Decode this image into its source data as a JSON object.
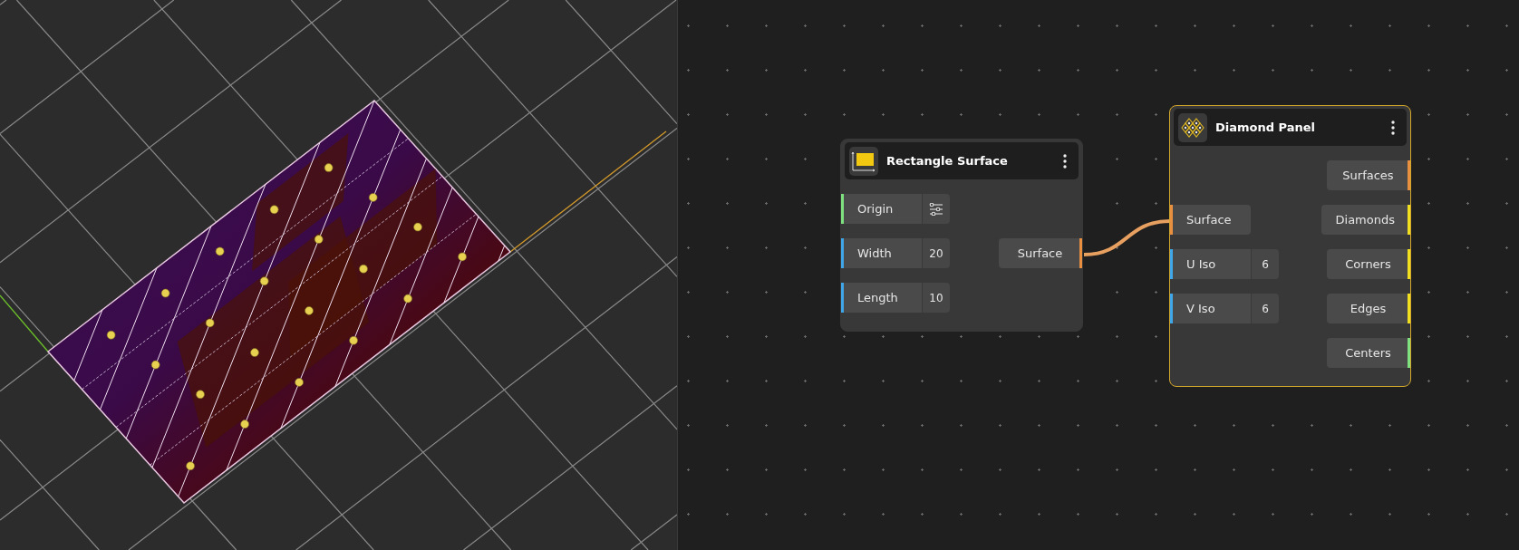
{
  "nodes": [
    {
      "title": "Rectangle Surface",
      "kind": "rectangle",
      "selected": false,
      "inputs": [
        {
          "label": "Origin",
          "kind": "settings",
          "color": "#7ee07e"
        },
        {
          "label": "Width",
          "kind": "number",
          "value": "20",
          "color": "#3fa6e8"
        },
        {
          "label": "Length",
          "kind": "number",
          "value": "10",
          "color": "#3fa6e8"
        }
      ],
      "outputs": [
        {
          "label": "Surface",
          "color": "#e8903f"
        }
      ]
    },
    {
      "title": "Diamond Panel",
      "kind": "diamond",
      "selected": true,
      "inputs": [
        {
          "label": "Surface",
          "kind": "plain",
          "color": "#e8903f"
        },
        {
          "label": "U Iso",
          "kind": "number",
          "value": "6",
          "color": "#3fa6e8"
        },
        {
          "label": "V Iso",
          "kind": "number",
          "value": "6",
          "color": "#3fa6e8"
        }
      ],
      "outputs": [
        {
          "label": "Surfaces",
          "color": "#e8903f"
        },
        {
          "label": "Diamonds",
          "color": "#f0e020"
        },
        {
          "label": "Corners",
          "color": "#f0e020"
        },
        {
          "label": "Edges",
          "color": "#f0e020"
        },
        {
          "label": "Centers",
          "color": "#7ee07e"
        }
      ]
    }
  ]
}
